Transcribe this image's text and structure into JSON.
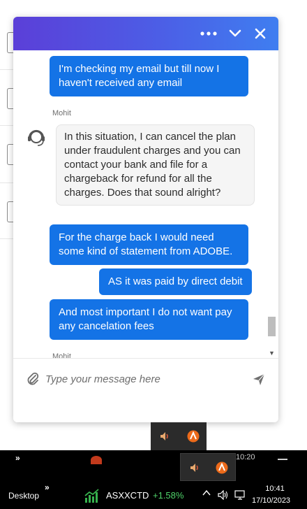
{
  "chat": {
    "header": {
      "more_icon": "more-dots-icon",
      "minimize_icon": "chevron-down-icon",
      "close_icon": "close-icon"
    },
    "messages": [
      {
        "from": "user",
        "text": "I'm checking my email but till now I haven't received any email"
      },
      {
        "from": "agent",
        "name": "Mohit",
        "text": "In this situation, I can cancel the plan under fraudulent charges and you can contact your bank and file for a chargeback for refund for all the charges. Does that sound alright?"
      },
      {
        "from": "user",
        "text": "For the charge back I would need some kind of statement from ADOBE."
      },
      {
        "from": "user",
        "text": "AS it was paid by direct debit"
      },
      {
        "from": "user",
        "text": "And most important I do not want pay any cancelation fees"
      },
      {
        "from": "agent",
        "name": "Mohit"
      }
    ],
    "composer": {
      "placeholder": "Type your message here"
    },
    "colors": {
      "user_bubble": "#1473e6",
      "header_start": "#5b3fd8",
      "header_end": "#3f7ef0"
    }
  },
  "taskbar": {
    "desktop_label": "Desktop",
    "ticker_symbol": "ASXXCTD",
    "ticker_change": "+1.58%",
    "time": "10:41",
    "date": "17/10/2023",
    "ghost_time": "10:20"
  }
}
